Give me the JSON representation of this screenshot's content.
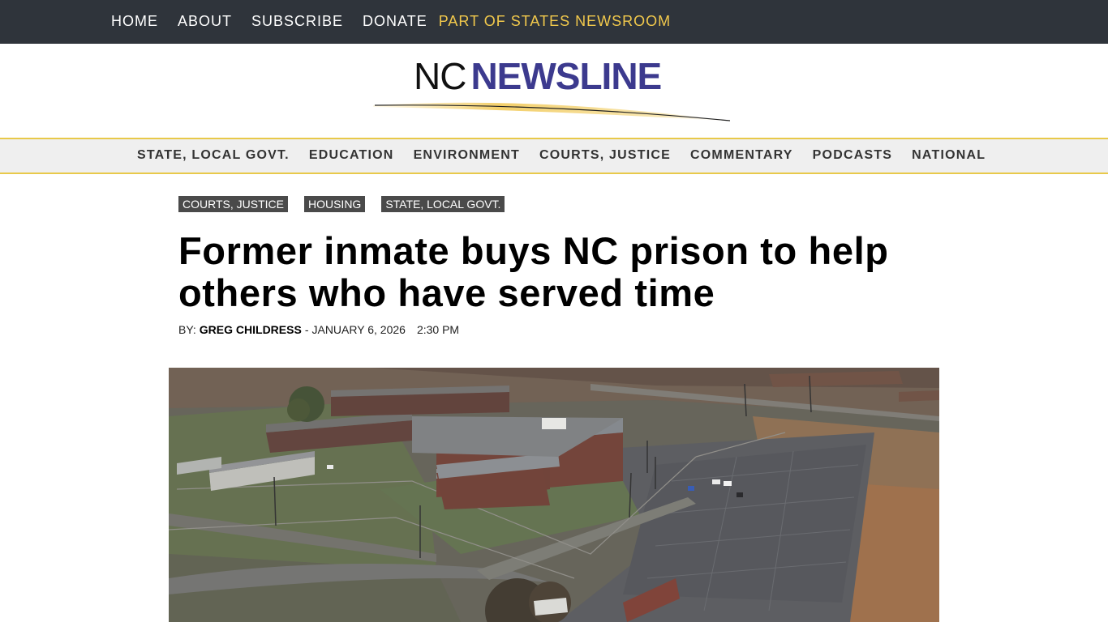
{
  "topnav": {
    "items": [
      "HOME",
      "ABOUT",
      "SUBSCRIBE",
      "DONATE"
    ],
    "network_link": "PART OF STATES NEWSROOM"
  },
  "logo": {
    "part1": "NC",
    "part2": "NEWSLINE"
  },
  "sections": [
    "STATE, LOCAL GOVT.",
    "EDUCATION",
    "ENVIRONMENT",
    "COURTS, JUSTICE",
    "COMMENTARY",
    "PODCASTS",
    "NATIONAL"
  ],
  "article": {
    "tags": [
      "COURTS, JUSTICE",
      "HOUSING",
      "STATE, LOCAL GOVT."
    ],
    "headline": "Former inmate buys NC prison to help others who have served time",
    "byline": {
      "prefix": "BY:",
      "author": "GREG CHILDRESS",
      "separator": "-",
      "date": "JANUARY 6, 2026",
      "time": "2:30 PM"
    }
  },
  "colors": {
    "topbar_bg": "#2f343b",
    "accent_yellow": "#f2c94c",
    "logo_purple": "#3c3a8e",
    "tag_bg": "#4a4a4a"
  }
}
